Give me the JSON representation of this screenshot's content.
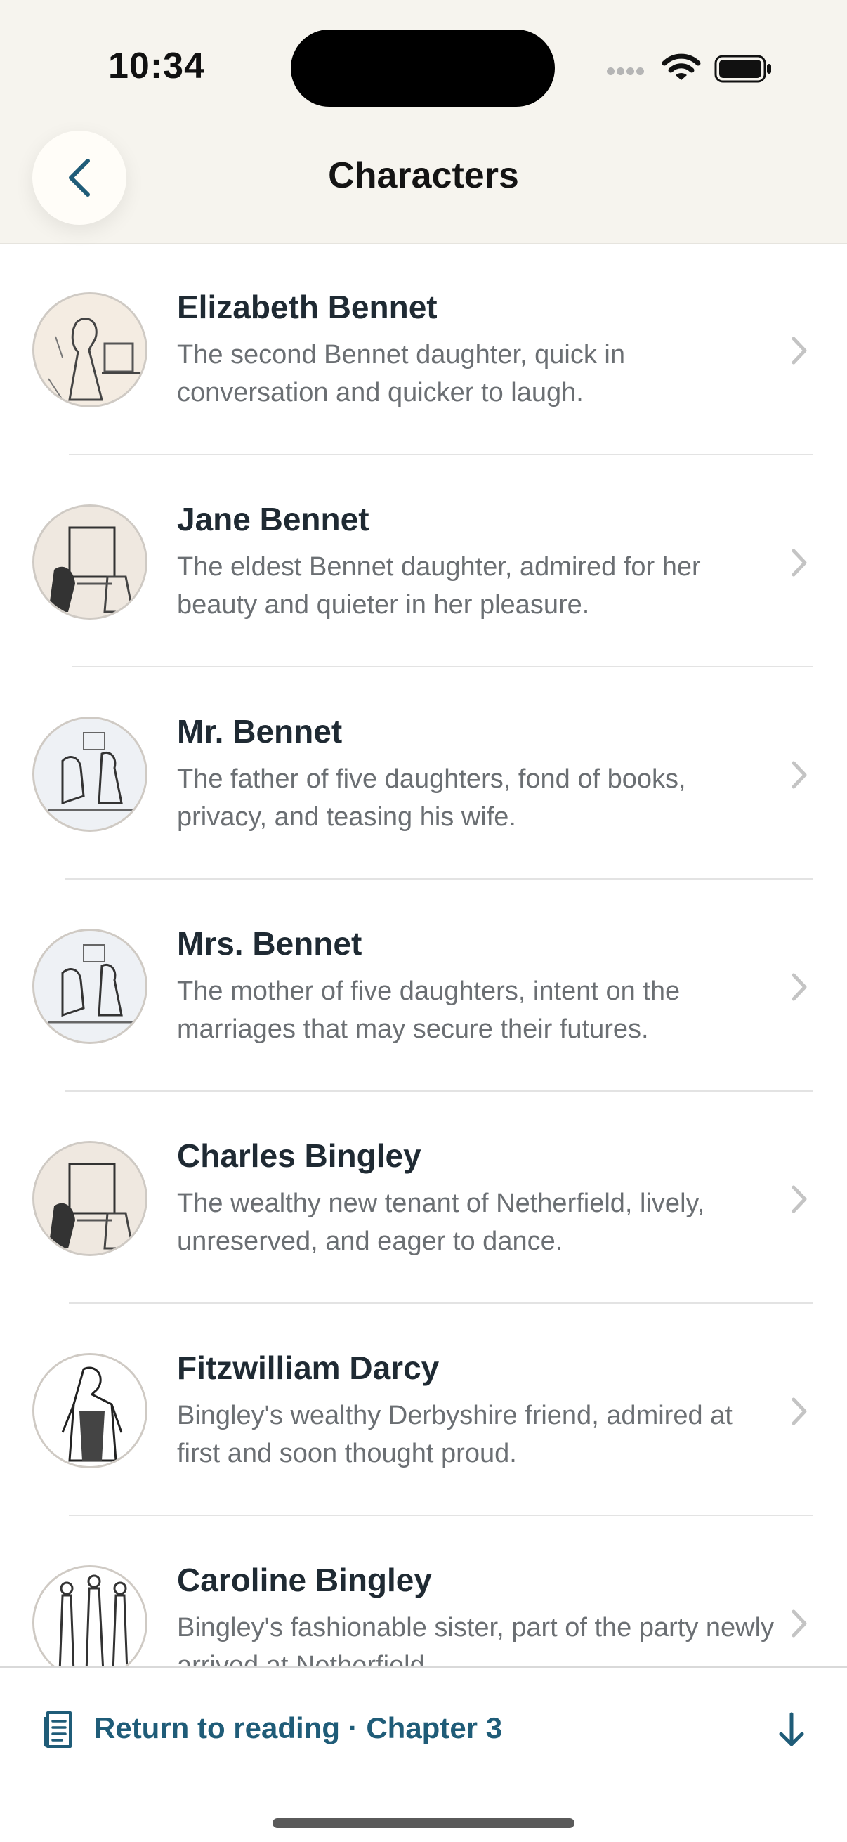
{
  "status_bar": {
    "time": "10:34"
  },
  "header": {
    "title": "Characters"
  },
  "colors": {
    "accent": "#1f5c78",
    "background": "#f6f4ee",
    "text": "#1f2a33",
    "secondary_text": "#6b6f73"
  },
  "characters": [
    {
      "name": "Elizabeth Bennet",
      "description": "The second Bennet daughter, quick in conversation and quicker to laugh."
    },
    {
      "name": "Jane Bennet",
      "description": "The eldest Bennet daughter, admired for her beauty and quieter in her pleasure."
    },
    {
      "name": "Mr. Bennet",
      "description": "The father of five daughters, fond of books, privacy, and teasing his wife."
    },
    {
      "name": "Mrs. Bennet",
      "description": "The mother of five daughters, intent on the marriages that may secure their futures."
    },
    {
      "name": "Charles Bingley",
      "description": "The wealthy new tenant of Netherfield, lively, unreserved, and eager to dance."
    },
    {
      "name": "Fitzwilliam Darcy",
      "description": "Bingley's wealthy Derbyshire friend, admired at first and soon thought proud."
    },
    {
      "name": "Caroline Bingley",
      "description": "Bingley's fashionable sister, part of the party newly arrived at Netherfield."
    }
  ],
  "bottom_bar": {
    "return_label": "Return to reading · Chapter 3"
  },
  "icons": {
    "back": "chevron-left-icon",
    "row": "chevron-right-icon",
    "book": "book-icon",
    "jump": "arrow-down-icon"
  }
}
